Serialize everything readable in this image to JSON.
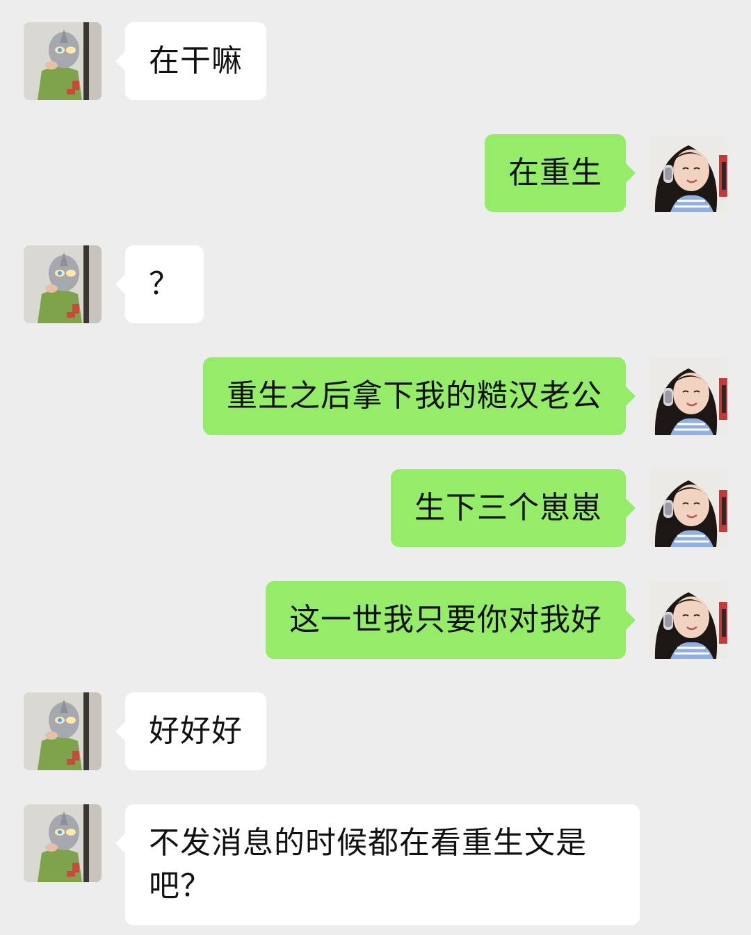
{
  "contacts": {
    "other": {
      "avatar_icon": "masked-hero-avatar-icon"
    },
    "me": {
      "avatar_icon": "girl-with-headphones-avatar-icon"
    }
  },
  "colors": {
    "background": "#ededed",
    "incoming_bubble": "#ffffff",
    "outgoing_bubble": "#95ec69"
  },
  "messages": [
    {
      "from": "other",
      "text": "在干嘛"
    },
    {
      "from": "me",
      "text": "在重生"
    },
    {
      "from": "other",
      "text": "？"
    },
    {
      "from": "me",
      "text": "重生之后拿下我的糙汉老公"
    },
    {
      "from": "me",
      "text": "生下三个崽崽"
    },
    {
      "from": "me",
      "text": "这一世我只要你对我好"
    },
    {
      "from": "other",
      "text": "好好好"
    },
    {
      "from": "other",
      "text": "不发消息的时候都在看重生文是吧？"
    }
  ]
}
